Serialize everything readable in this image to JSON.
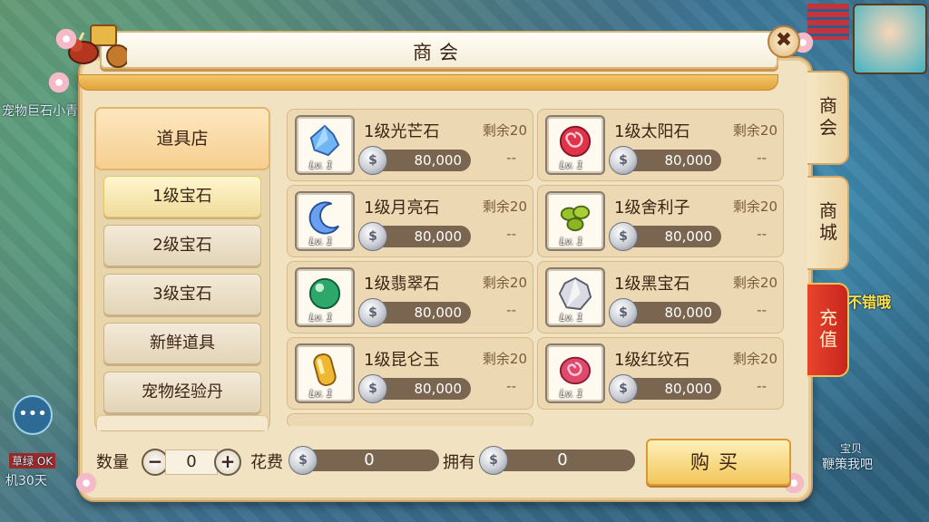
{
  "window": {
    "title": "商会",
    "close_label": "✖"
  },
  "background_text": {
    "left_name": "宠物巨石小青",
    "left_bottom": "机30天",
    "left_badge": "草绿 OK",
    "right_promo": "不错哦",
    "right_bottom": "鞭策我吧",
    "right_small": "宝贝"
  },
  "category": {
    "header": "道具店",
    "items": [
      {
        "label": "1级宝石",
        "active": true
      },
      {
        "label": "2级宝石",
        "active": false
      },
      {
        "label": "3级宝石",
        "active": false
      },
      {
        "label": "新鲜道具",
        "active": false
      },
      {
        "label": "宠物经验丹",
        "active": false
      }
    ]
  },
  "items": [
    {
      "name": "1级光芒石",
      "remain": "剩余20",
      "price": "80,000",
      "level": "Lv. 1",
      "owned": "--",
      "color": "#5aa8e8",
      "icon": "crystal-cluster-icon"
    },
    {
      "name": "1级太阳石",
      "remain": "剩余20",
      "price": "80,000",
      "level": "Lv. 1",
      "owned": "--",
      "color": "#e0344a",
      "icon": "red-spiral-orb-icon"
    },
    {
      "name": "1级月亮石",
      "remain": "剩余20",
      "price": "80,000",
      "level": "Lv. 1",
      "owned": "--",
      "color": "#6aa0f0",
      "icon": "blue-crescent-icon"
    },
    {
      "name": "1级舍利子",
      "remain": "剩余20",
      "price": "80,000",
      "level": "Lv. 1",
      "owned": "--",
      "color": "#9ac22c",
      "icon": "green-beads-icon"
    },
    {
      "name": "1级翡翠石",
      "remain": "剩余20",
      "price": "80,000",
      "level": "Lv. 1",
      "owned": "--",
      "color": "#2ea86a",
      "icon": "green-orb-icon"
    },
    {
      "name": "1级黑宝石",
      "remain": "剩余20",
      "price": "80,000",
      "level": "Lv. 1",
      "owned": "--",
      "color": "#cfd0d8",
      "icon": "silver-diamond-icon"
    },
    {
      "name": "1级昆仑玉",
      "remain": "剩余20",
      "price": "80,000",
      "level": "Lv. 1",
      "owned": "--",
      "color": "#f0b830",
      "icon": "golden-jade-icon"
    },
    {
      "name": "1级红纹石",
      "remain": "剩余20",
      "price": "80,000",
      "level": "Lv. 1",
      "owned": "--",
      "color": "#e04a6a",
      "icon": "pink-swirl-orb-icon"
    }
  ],
  "purchase": {
    "quantity_label": "数量",
    "quantity_value": "0",
    "minus": "−",
    "plus": "+",
    "cost_label": "花费",
    "cost_value": "0",
    "owned_label": "拥有",
    "owned_value": "0",
    "buy_label": "购买"
  },
  "side_tabs": [
    {
      "label": "商会",
      "active": false
    },
    {
      "label": "商城",
      "active": false
    },
    {
      "label": "充值",
      "active": true
    }
  ],
  "coin_glyph": "$"
}
